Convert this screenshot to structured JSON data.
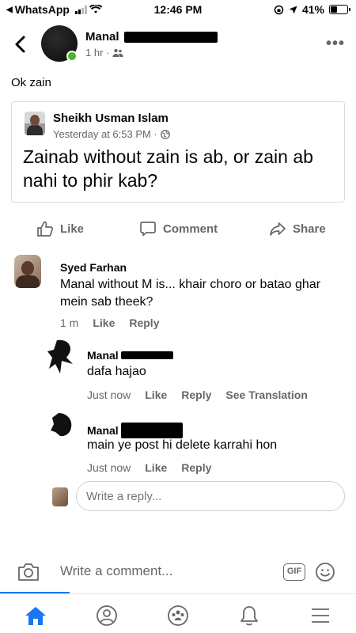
{
  "status_bar": {
    "back_app": "WhatsApp",
    "time": "12:46 PM",
    "battery": "41%",
    "battery_level": 0.41
  },
  "header": {
    "name": "Manal",
    "time": "1 hr ·"
  },
  "post": {
    "text": "Ok zain"
  },
  "shared": {
    "author": "Sheikh Usman Islam",
    "time": "Yesterday at 6:53 PM ·",
    "text": "Zainab without zain is ab, or zain ab nahi to phir kab?"
  },
  "actions": {
    "like": "Like",
    "comment": "Comment",
    "share": "Share"
  },
  "comments": [
    {
      "author": "Syed Farhan",
      "text": "Manal without M is... khair choro or batao ghar mein sab theek?",
      "time": "1 m",
      "like": "Like",
      "reply": "Reply"
    },
    {
      "author": "Manal",
      "text": "dafa hajao",
      "time": "Just now",
      "like": "Like",
      "reply": "Reply",
      "translate": "See Translation"
    },
    {
      "author": "Manal",
      "text": "main ye post hi delete karrahi hon",
      "time": "Just now",
      "like": "Like",
      "reply": "Reply"
    }
  ],
  "reply_box": {
    "placeholder": "Write a reply..."
  },
  "comment_bar": {
    "placeholder": "Write a comment...",
    "gif": "GIF"
  },
  "colors": {
    "accent": "#1877f2",
    "online": "#42b72a",
    "secondary_text": "#65676b"
  }
}
